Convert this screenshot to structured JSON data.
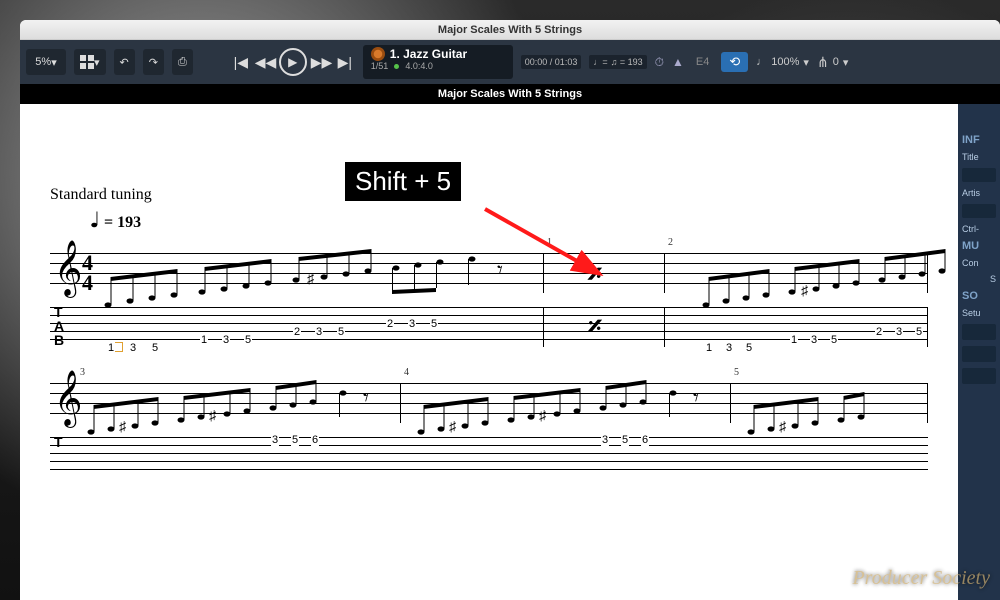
{
  "window_title": "Major Scales With 5 Strings",
  "toolbar": {
    "zoom_value": "5%",
    "undo_icon": "↶",
    "redo_icon": "↷",
    "print_icon": "⎙",
    "transport": {
      "go_start": "|◀",
      "rewind": "◀◀",
      "play": "▶",
      "forward": "▶▶",
      "go_end": "▶|"
    },
    "track": {
      "name": "1. Jazz Guitar",
      "bar_position": "1/51",
      "beat_info": "4.0:4.0",
      "time_counter": "00:00 / 01:03",
      "tempo_label": "♩=",
      "tempo_value": "193"
    },
    "chord_label": "E4",
    "loop_icon": "⟲",
    "playback_speed": "100%",
    "tuning_icon": "⋔",
    "tuning_value": "0"
  },
  "subheader_title": "Major Scales With 5 Strings",
  "score": {
    "tuning_text": "Standard tuning",
    "tempo_display": "= 193",
    "time_signature": {
      "top": "4",
      "bottom": "4"
    },
    "tab_letters": [
      "T",
      "A",
      "B"
    ],
    "measure_numbers_system1": [
      "1",
      "2"
    ],
    "measure_numbers_system2": [
      "3",
      "4",
      "5"
    ],
    "simile_symbol": "𝄎",
    "tab_frets_run": [
      "1",
      "3",
      "5",
      "1",
      "3",
      "5",
      "2",
      "3",
      "5",
      "2",
      "3",
      "5"
    ]
  },
  "sidepanel": {
    "heading_information": "INF",
    "label_title": "Title",
    "label_artist": "Artis",
    "label_ctrl": "Ctrl-",
    "heading_music": "MU",
    "label_con": "Con",
    "label_s": "S",
    "heading_sound": "SO",
    "label_setup": "Setu"
  },
  "overlay": {
    "shortcut_text": "Shift + 5"
  },
  "watermark": "Producer Society"
}
